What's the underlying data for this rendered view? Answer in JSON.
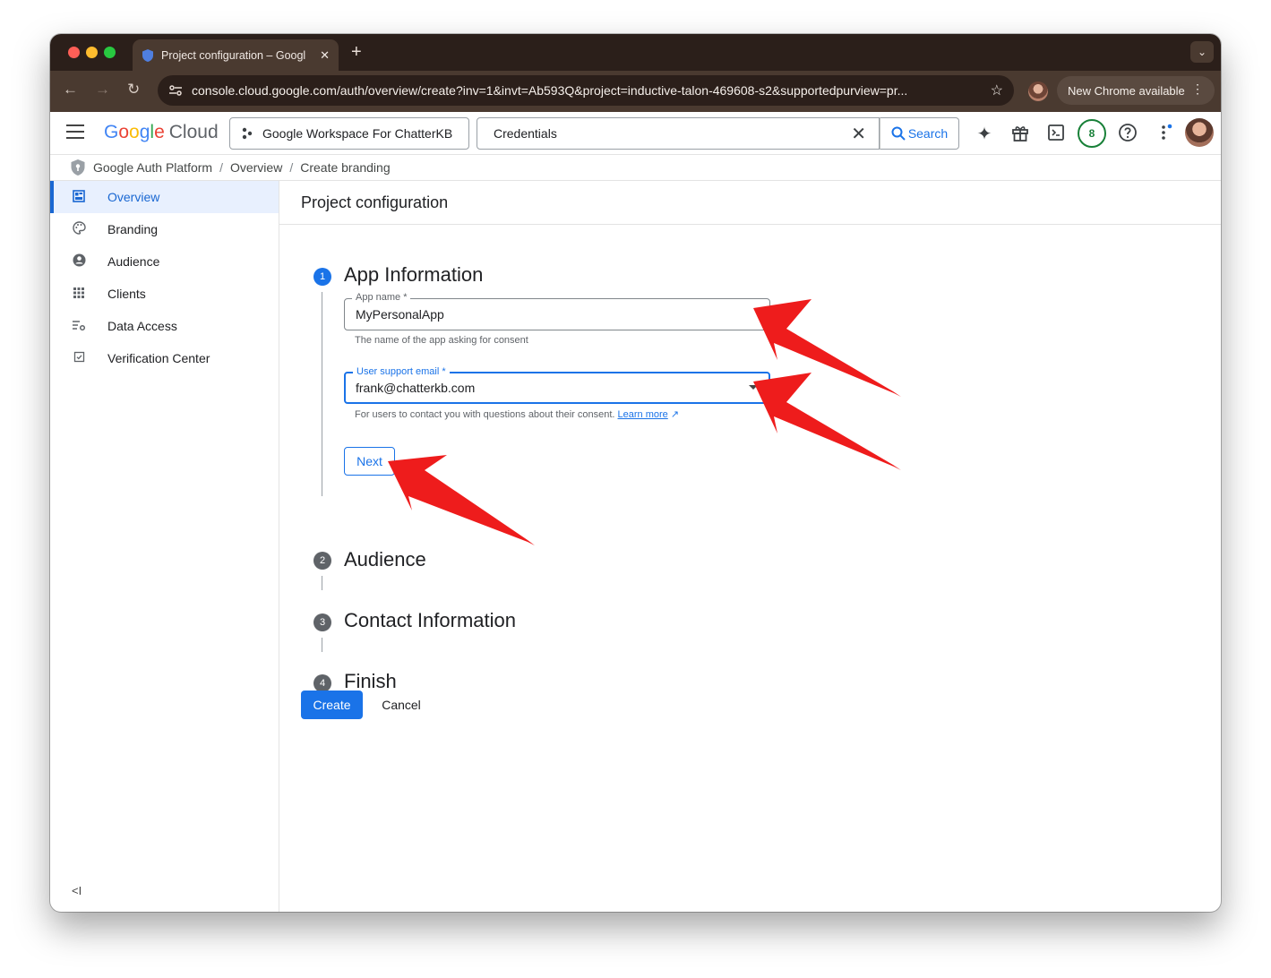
{
  "browser": {
    "tab_title": "Project configuration – Googl",
    "new_tab_glyph": "+",
    "url": "console.cloud.google.com/auth/overview/create?inv=1&invt=Ab593Q&project=inductive-talon-469608-s2&supportedpurview=pr...",
    "update_label": "New Chrome available"
  },
  "header": {
    "logo_word": "Google",
    "logo_product": "Cloud",
    "project": "Google Workspace For ChatterKB",
    "search_value": "Credentials",
    "search_button": "Search",
    "notifications_count": "8"
  },
  "breadcrumb": [
    "Google Auth Platform",
    "Overview",
    "Create branding"
  ],
  "sidebar": {
    "items": [
      {
        "label": "Overview",
        "icon": "dashboard-icon"
      },
      {
        "label": "Branding",
        "icon": "palette-icon"
      },
      {
        "label": "Audience",
        "icon": "account-circle-icon"
      },
      {
        "label": "Clients",
        "icon": "apps-grid-icon"
      },
      {
        "label": "Data Access",
        "icon": "data-access-icon"
      },
      {
        "label": "Verification Center",
        "icon": "verification-icon"
      }
    ],
    "collapse_glyph": "<I"
  },
  "main": {
    "page_title": "Project configuration",
    "steps": [
      {
        "number": "1",
        "title": "App Information"
      },
      {
        "number": "2",
        "title": "Audience"
      },
      {
        "number": "3",
        "title": "Contact Information"
      },
      {
        "number": "4",
        "title": "Finish"
      }
    ],
    "app_name": {
      "label": "App name *",
      "value": "MyPersonalApp",
      "hint": "The name of the app asking for consent"
    },
    "support_email": {
      "label": "User support email *",
      "value": "frank@chatterkb.com",
      "hint": "For users to contact you with questions about their consent.",
      "link": "Learn more"
    },
    "next_label": "Next",
    "create_label": "Create",
    "cancel_label": "Cancel"
  },
  "colors": {
    "accent": "#1a73e8",
    "annotation": "#ee1c1c",
    "chrome_frame": "#2b1f1a"
  }
}
